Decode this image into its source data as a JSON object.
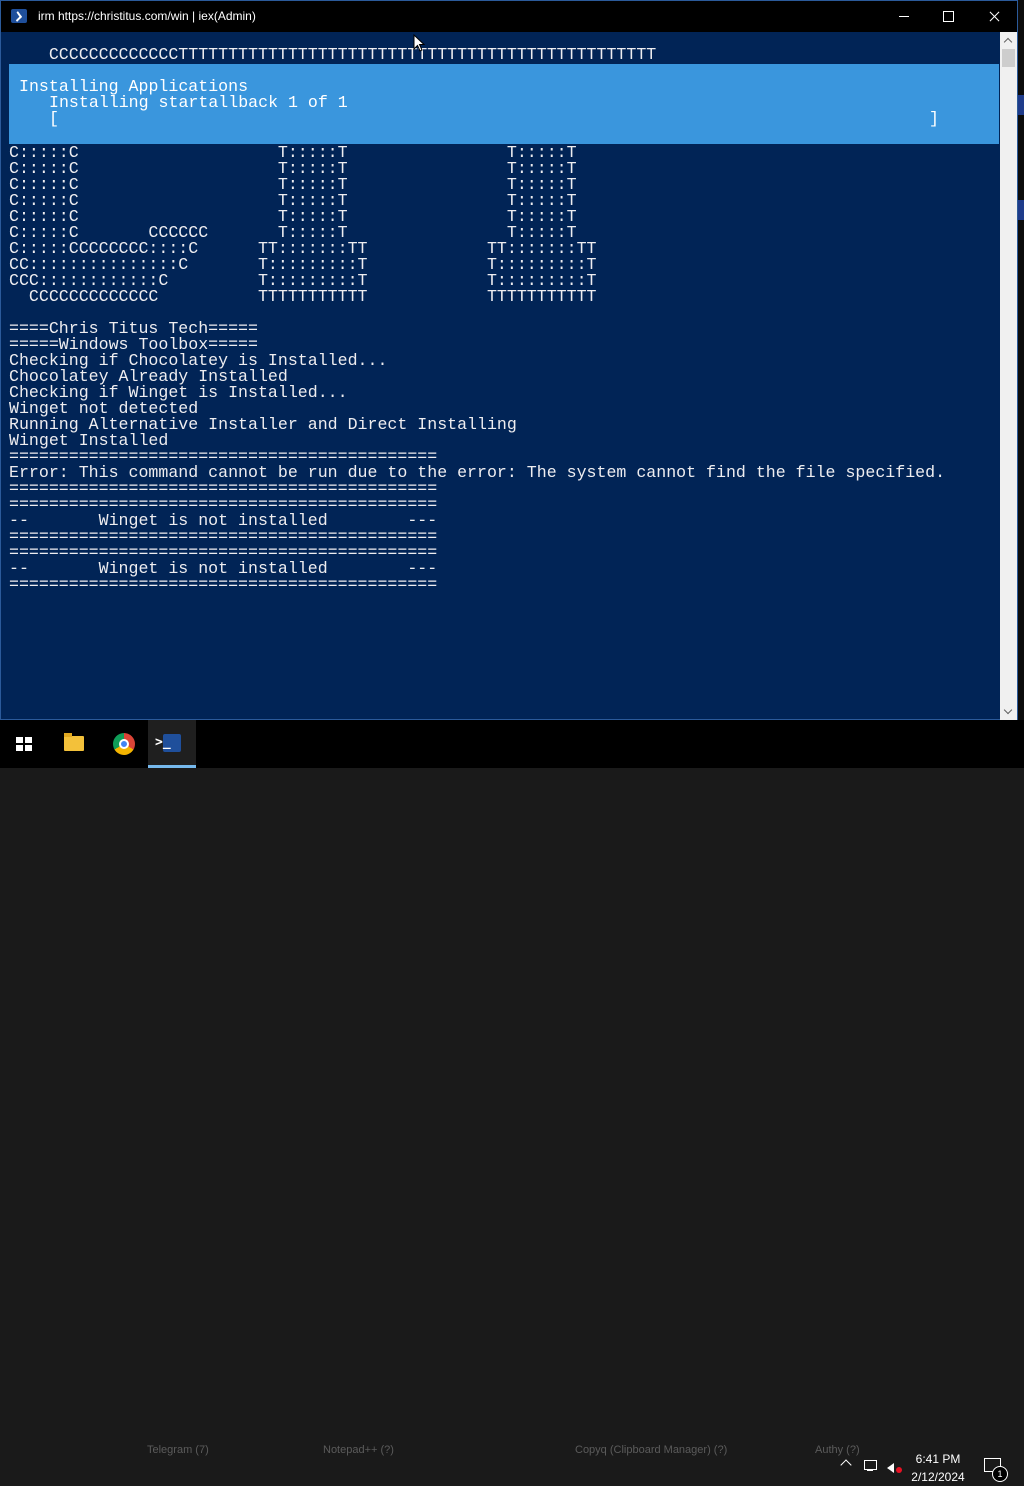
{
  "window": {
    "title": "irm https://christitus.com/win | iex(Admin)"
  },
  "banner_top": "    CCCCCCCCCCCCCTTTTTTTTTTTTTTTTTTTTTTTTTTTTTTTTTTTTTTTTTTTTTTTT",
  "progress": {
    "activity": "Installing Applications",
    "status": "Installing startallback 1 of 1",
    "bar_left": "[",
    "bar_right": "]"
  },
  "terminal_lines": [
    "C:::::C                    T:::::T                T:::::T",
    "C:::::C                    T:::::T                T:::::T",
    "C:::::C                    T:::::T                T:::::T",
    "C:::::C                    T:::::T                T:::::T",
    "C:::::C                    T:::::T                T:::::T",
    "C:::::C       CCCCCC       T:::::T                T:::::T",
    "C:::::CCCCCCCC::::C      TT:::::::TT            TT:::::::TT",
    "CC:::::::::::::::C       T:::::::::T            T:::::::::T",
    "CCC::::::::::::C         T:::::::::T            T:::::::::T",
    "  CCCCCCCCCCCCC          TTTTTTTTTTT            TTTTTTTTTTT",
    "",
    "====Chris Titus Tech=====",
    "=====Windows Toolbox=====",
    "Checking if Chocolatey is Installed...",
    "Chocolatey Already Installed",
    "Checking if Winget is Installed...",
    "Winget not detected",
    "Running Alternative Installer and Direct Installing",
    "Winget Installed",
    "===========================================",
    "Error: This command cannot be run due to the error: The system cannot find the file specified.",
    "===========================================",
    "===========================================",
    "--       Winget is not installed        ---",
    "===========================================",
    "===========================================",
    "--       Winget is not installed        ---",
    "==========================================="
  ],
  "taskbar": {
    "pinned": [
      "start-icon",
      "file-explorer-icon",
      "chrome-icon",
      "powershell-icon"
    ],
    "background_labels": [
      "Telegram (7)",
      "Notepad++ (?)",
      "Copyq (Clipboard Manager) (?)",
      "Authy (?)"
    ],
    "clock_time": "6:41 PM",
    "clock_date": "2/12/2024",
    "notification_count": "1"
  },
  "colors": {
    "console_bg": "#012456",
    "progress_bg": "#3a96dd",
    "titlebar_bg": "#000000"
  }
}
